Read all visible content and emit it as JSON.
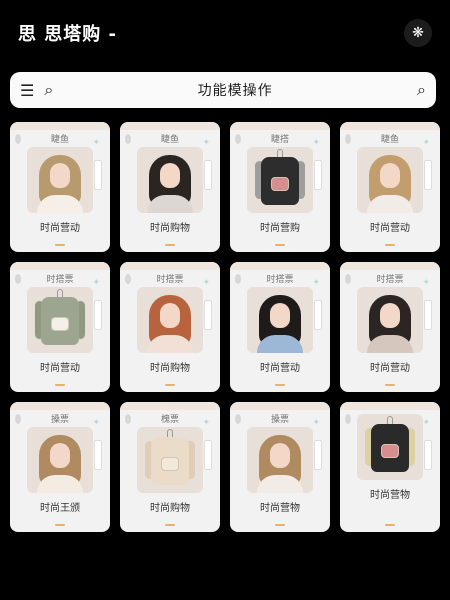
{
  "header": {
    "title": "思 思塔购 -",
    "icon": "butterfly-icon"
  },
  "search": {
    "title": "功能模操作",
    "menu_icon": "menu-icon",
    "search_icon": "search-icon"
  },
  "cards": [
    {
      "tag": "睫鱼",
      "label": "时尚营动",
      "type": "person",
      "hair": "#b89a6f",
      "shoulder": "#f6efe8"
    },
    {
      "tag": "睫鱼",
      "label": "时尚购物",
      "type": "person",
      "hair": "#2b2522",
      "shoulder": "#ddd7d3"
    },
    {
      "tag": "睫搭",
      "label": "时尚营购",
      "type": "jacket",
      "jacket": "#2d2d2d",
      "sleeve": "#9e9e9e",
      "bag": "#d78e8e"
    },
    {
      "tag": "睫鱼",
      "label": "时尚营动",
      "type": "person",
      "hair": "#c29e6f",
      "shoulder": "#f1ece8"
    },
    {
      "tag": "时搭票",
      "label": "时尚营动",
      "type": "jacket",
      "jacket": "#9ba58f",
      "sleeve": "#8f997f",
      "bag": "#f4efe7"
    },
    {
      "tag": "时搭票",
      "label": "时尚购物",
      "type": "person",
      "hair": "#b7643e",
      "shoulder": "#f2dfd5"
    },
    {
      "tag": "时搭票",
      "label": "时尚营动",
      "type": "person",
      "hair": "#1f1b1a",
      "shoulder": "#9cb8d6"
    },
    {
      "tag": "时搭票",
      "label": "时尚营动",
      "type": "person",
      "hair": "#2b2523",
      "shoulder": "#d6c7be"
    },
    {
      "tag": "搡票",
      "label": "时尚王颁",
      "type": "person",
      "hair": "#b08a61",
      "shoulder": "#f4ece3"
    },
    {
      "tag": "槐票",
      "label": "时尚购物",
      "type": "jacket",
      "jacket": "#eadcc8",
      "sleeve": "#dfcdb5",
      "bag": "#f3e9d8"
    },
    {
      "tag": "搡票",
      "label": "时尚营物",
      "type": "person",
      "hair": "#b08a61",
      "shoulder": "#f2ebe6"
    },
    {
      "tag": "",
      "label": "时尚营物",
      "type": "jacket",
      "jacket": "#2a2a2a",
      "sleeve": "#ddd0a3",
      "bag": "#d78e8e"
    }
  ]
}
